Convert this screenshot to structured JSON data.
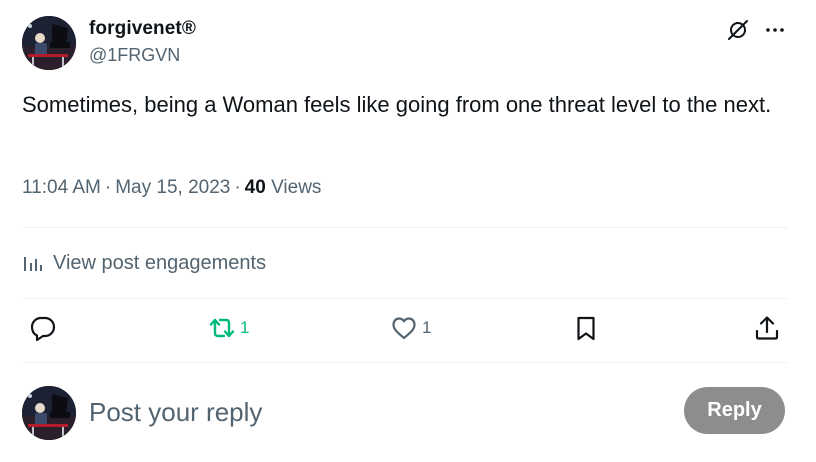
{
  "author": {
    "display_name": "forgivenet®",
    "handle": "@1FRGVN",
    "avatar_icon": "avatar-image"
  },
  "tweet": {
    "text": "Sometimes, being a Woman feels like going from one threat level to the next.",
    "time": "11:04 AM",
    "separator": "·",
    "date": "May 15, 2023",
    "views_count": "40",
    "views_label": "Views"
  },
  "engagements": {
    "label": "View post engagements",
    "icon": "analytics-icon"
  },
  "actions": {
    "reply_count": "",
    "retweet_count": "1",
    "like_count": "1",
    "retweet_active_color": "#00ba7c"
  },
  "reply_box": {
    "placeholder": "Post your reply",
    "button_label": "Reply"
  },
  "colors": {
    "text_primary": "#0f1419",
    "text_secondary": "#536471",
    "divider": "#eff3f4",
    "reply_button_disabled": "#8b8d8f"
  }
}
